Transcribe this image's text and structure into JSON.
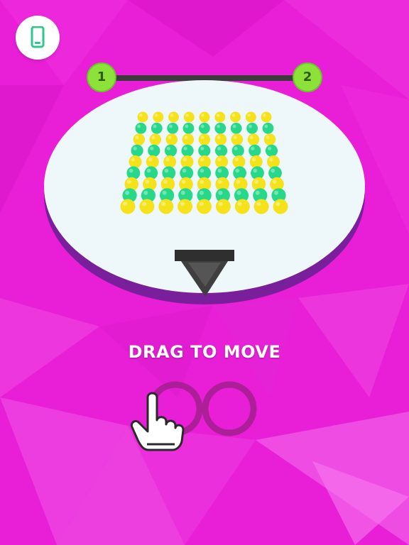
{
  "hud": {
    "device_icon": "phone-icon",
    "level_current": "1",
    "level_next": "2"
  },
  "board": {
    "ball_grid": {
      "rows": [
        "YYYYYYYYY",
        "GGGGGGGGG",
        "YYYYYYYYY",
        "GGGGGGGGG",
        "YYYYYYYYY",
        "GGGGGGGGG",
        "YYYYYYYYY",
        "GGGGGGGGG",
        "YYYYYYYYY"
      ]
    },
    "colors": {
      "yellow": "#f6e21a",
      "green": "#27d88a",
      "platform": "#eef8fb",
      "platform_edge": "#7a1f9c",
      "pusher": "#3f3f3f",
      "background": "#e81fd6"
    }
  },
  "tutorial": {
    "hint": "DRAG TO MOVE",
    "hand_icon": "pointing-hand-icon",
    "path_icon": "infinity-path-icon"
  }
}
